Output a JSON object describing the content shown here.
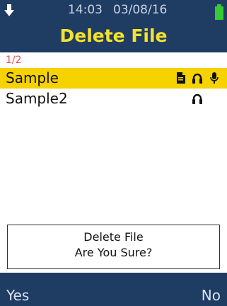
{
  "status": {
    "time": "14:03",
    "date": "03/08/16",
    "battery_color": "#33cc33"
  },
  "header": {
    "title": "Delete File",
    "background": "#1f3c63",
    "title_color": "#f5e22c"
  },
  "list": {
    "page_indicator": "1/2",
    "items": [
      {
        "name": "Sample",
        "selected": true,
        "icons": [
          "document-icon",
          "headphones-icon",
          "microphone-icon"
        ]
      },
      {
        "name": "Sample2",
        "selected": false,
        "icons": [
          "headphones-icon"
        ]
      }
    ],
    "selection_color": "#f5d200"
  },
  "dialog": {
    "line1": "Delete File",
    "line2": "Are You Sure?"
  },
  "softkeys": {
    "left": "Yes",
    "right": "No"
  }
}
